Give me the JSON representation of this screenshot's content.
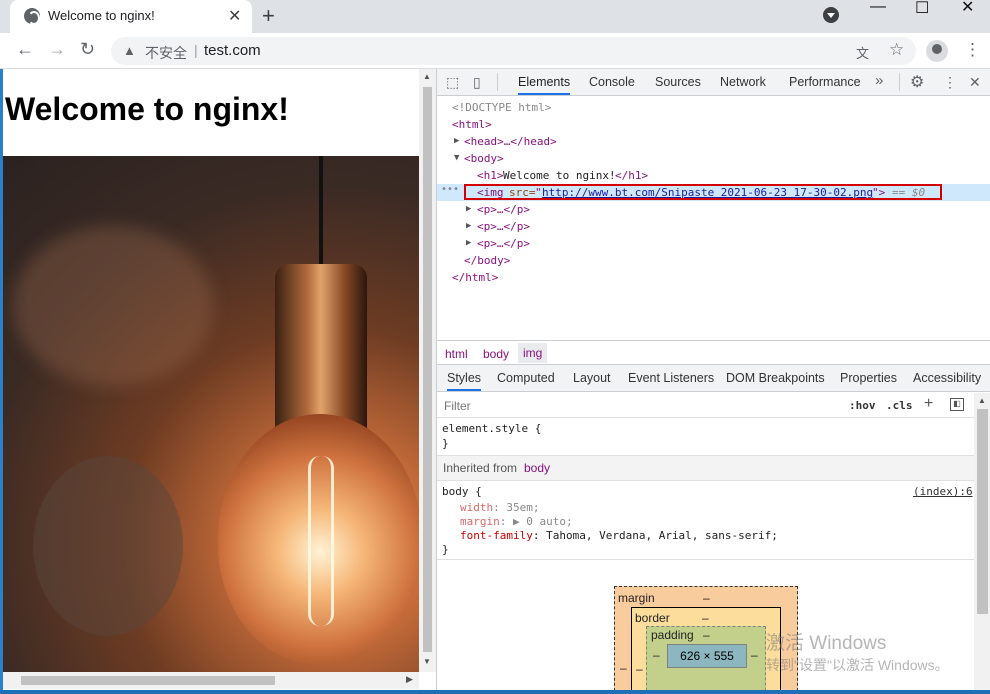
{
  "tab": {
    "title": "Welcome to nginx!",
    "close": "✕"
  },
  "window": {
    "minimize": "—",
    "maximize": "☐",
    "close": "✕",
    "new_tab": "+"
  },
  "toolbar": {
    "back": "←",
    "forward": "→",
    "reload": "↻",
    "security_icon": "▲",
    "security_text": "不安全",
    "separator": "|",
    "url": "test.com",
    "translate_icon": "文",
    "bookmark_icon": "☆",
    "menu": "⋮"
  },
  "page": {
    "heading": "Welcome to nginx!"
  },
  "devtools": {
    "tabs": [
      "Elements",
      "Console",
      "Sources",
      "Network",
      "Performance"
    ],
    "more": "»",
    "settings": "⚙",
    "kebab": "⋮",
    "close": "✕",
    "inspect_icon": "⬚",
    "device_icon": "▯",
    "dom": {
      "doctype": "<!DOCTYPE html>",
      "html_open": "<html>",
      "head": "<head>…</head>",
      "body_open": "<body>",
      "h1_open": "<h1>",
      "h1_text": "Welcome to nginx!",
      "h1_close": "</h1>",
      "img_tag": "<img",
      "img_attr": "src=",
      "img_q1": "\"",
      "img_src": "http://www.bt.com/Snipaste_2021-06-23_17-30-02.png",
      "img_q2": "\">",
      "img_eq": "== $0",
      "p": "<p>…</p>",
      "body_close": "</body>",
      "html_close": "</html>",
      "ellipsis": "•••"
    },
    "breadcrumbs": [
      "html",
      "body",
      "img"
    ],
    "style_tabs": [
      "Styles",
      "Computed",
      "Layout",
      "Event Listeners",
      "DOM Breakpoints",
      "Properties",
      "Accessibility"
    ],
    "filter_placeholder": "Filter",
    "hov": ":hov",
    "cls": ".cls",
    "add": "+",
    "toggle": "◧",
    "element_style": "element.style {",
    "brace_close": "}",
    "inherited_label": "Inherited from",
    "inherited_from": "body",
    "rule": {
      "selector": "body {",
      "source": "(index):6",
      "decls": [
        {
          "name": "width",
          "value": "35em;"
        },
        {
          "name": "margin",
          "value": "▶ 0 auto;"
        },
        {
          "name": "font-family",
          "value": "Tahoma, Verdana, Arial, sans-serif;"
        }
      ]
    },
    "box_model": {
      "margin": "margin",
      "border": "border",
      "padding": "padding",
      "dash": "–",
      "content": "626 × 555"
    }
  },
  "watermark": {
    "line1": "激活 Windows",
    "line2": "转到\"设置\"以激活 Windows。"
  },
  "colors": {
    "accent": "#1a73e8",
    "selection": "#cfe8fc",
    "highlight_box": "#d40000"
  }
}
